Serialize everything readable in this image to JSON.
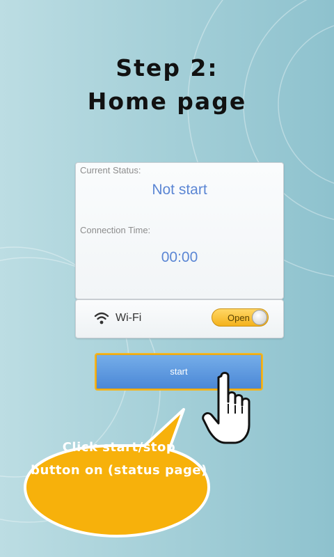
{
  "header": {
    "line1": "Step 2:",
    "line2": "Home page"
  },
  "status_card": {
    "status_label": "Current Status:",
    "status_value": "Not start",
    "time_label": "Connection Time:",
    "time_value": "00:00"
  },
  "wifi_row": {
    "icon": "wifi-icon",
    "label": "Wi-Fi",
    "toggle_label": "Open",
    "toggle_color": "#f4b21c"
  },
  "start_button": {
    "label": "start",
    "border_color": "#f4b51e"
  },
  "callout": {
    "line1": "Click start/stop",
    "line2": "button on (status page)",
    "color": "#f7b10b"
  }
}
